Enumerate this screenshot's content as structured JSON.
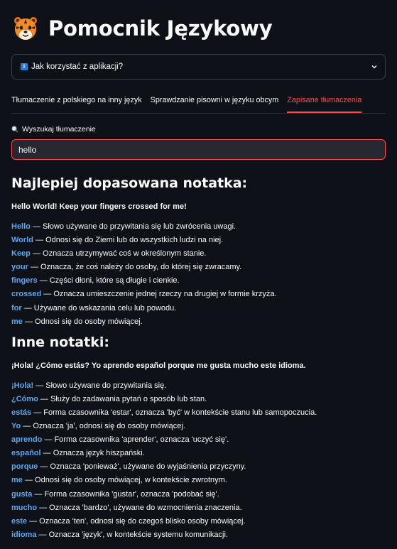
{
  "app": {
    "title": "Pomocnik Językowy",
    "logo_icon": "tiger-face-icon"
  },
  "expander": {
    "label": "Jak korzystać z aplikacji?",
    "icon": "info-icon",
    "expanded": false
  },
  "tabs": [
    {
      "label": "Tłumaczenie z polskiego na inny język",
      "active": false
    },
    {
      "label": "Sprawdzanie pisowni w języku obcym",
      "active": false
    },
    {
      "label": "Zapisane tłumaczenia",
      "active": true
    }
  ],
  "search": {
    "label": "Wyszukaj tłumaczenie",
    "value": "hello"
  },
  "best_match": {
    "heading": "Najlepiej dopasowana notatka:",
    "text": "Hello World! Keep your fingers crossed for me!",
    "definitions": [
      {
        "word": "Hello",
        "meaning": "Słowo używane do przywitania się lub zwrócenia uwagi."
      },
      {
        "word": "World",
        "meaning": "Odnosi się do Ziemi lub do wszystkich ludzi na niej."
      },
      {
        "word": "Keep",
        "meaning": "Oznacza utrzymywać coś w określonym stanie."
      },
      {
        "word": "your",
        "meaning": "Oznacza, że coś należy do osoby, do której się zwracamy."
      },
      {
        "word": "fingers",
        "meaning": "Części dłoni, które są długie i cienkie."
      },
      {
        "word": "crossed",
        "meaning": "Oznacza umieszczenie jednej rzeczy na drugiej w formie krzyża."
      },
      {
        "word": "for",
        "meaning": "Używane do wskazania celu lub powodu."
      },
      {
        "word": "me",
        "meaning": "Odnosi się do osoby mówiącej."
      }
    ]
  },
  "other_notes": {
    "heading": "Inne notatki:",
    "text": "¡Hola! ¿Cómo estás? Yo aprendo español porque me gusta mucho este idioma.",
    "definitions": [
      {
        "word": "¡Hola!",
        "meaning": "Słowo używane do przywitania się."
      },
      {
        "word": "¿Cómo",
        "meaning": "Służy do zadawania pytań o sposób lub stan."
      },
      {
        "word": "estás",
        "meaning": "Forma czasownika 'estar', oznacza 'być' w kontekście stanu lub samopoczucia."
      },
      {
        "word": "Yo",
        "meaning": "Oznacza 'ja', odnosi się do osoby mówiącej."
      },
      {
        "word": "aprendo",
        "meaning": "Forma czasownika 'aprender', oznacza 'uczyć się'."
      },
      {
        "word": "español",
        "meaning": "Oznacza język hiszpański."
      },
      {
        "word": "porque",
        "meaning": "Oznacza 'ponieważ', używane do wyjaśnienia przyczyny."
      },
      {
        "word": "me",
        "meaning": "Odnosi się do osoby mówiącej, w kontekście zwrotnym."
      },
      {
        "word": "gusta",
        "meaning": "Forma czasownika 'gustar', oznacza 'podobać się'."
      },
      {
        "word": "mucho",
        "meaning": "Oznacza 'bardzo', używane do wzmocnienia znaczenia."
      },
      {
        "word": "este",
        "meaning": "Oznacza 'ten', odnosi się do czegoś blisko osoby mówiącej."
      },
      {
        "word": "idioma",
        "meaning": "Oznacza 'język', w kontekście systemu komunikacji."
      }
    ]
  },
  "colors": {
    "background": "#0e1117",
    "accent": "#ff4b4b",
    "word_link": "#5aa8f2"
  }
}
